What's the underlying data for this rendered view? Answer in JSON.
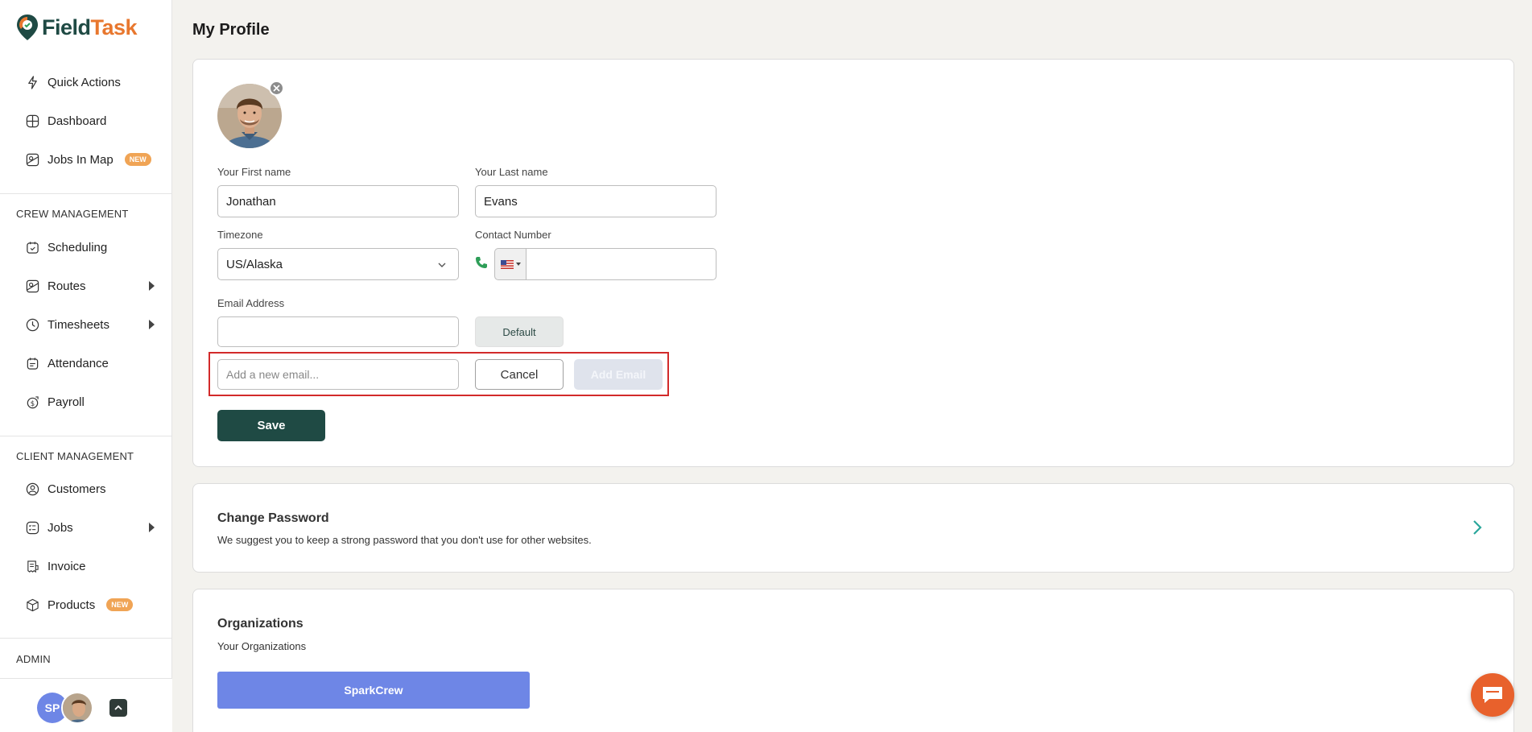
{
  "brand": {
    "name_part1": "Field",
    "name_part2": "Task",
    "primary_color": "#1f4a44",
    "accent_color": "#e8772e"
  },
  "sidebar": {
    "top_items": [
      {
        "label": "Quick Actions",
        "icon": "bolt-icon"
      },
      {
        "label": "Dashboard",
        "icon": "dashboard-icon"
      },
      {
        "label": "Jobs In Map",
        "icon": "map-icon",
        "badge": "NEW"
      }
    ],
    "crew_section": "CREW MANAGEMENT",
    "crew_items": [
      {
        "label": "Scheduling",
        "icon": "calendar-icon"
      },
      {
        "label": "Routes",
        "icon": "route-icon",
        "expandable": true
      },
      {
        "label": "Timesheets",
        "icon": "clock-icon",
        "expandable": true
      },
      {
        "label": "Attendance",
        "icon": "attendance-icon"
      },
      {
        "label": "Payroll",
        "icon": "payroll-icon"
      }
    ],
    "client_section": "CLIENT MANAGEMENT",
    "client_items": [
      {
        "label": "Customers",
        "icon": "customers-icon"
      },
      {
        "label": "Jobs",
        "icon": "jobs-icon",
        "expandable": true
      },
      {
        "label": "Invoice",
        "icon": "invoice-icon"
      },
      {
        "label": "Products",
        "icon": "box-icon",
        "badge": "NEW"
      }
    ],
    "admin_section": "ADMIN",
    "footer": {
      "initials": "SP"
    }
  },
  "page": {
    "title": "My Profile"
  },
  "profile": {
    "first_name_label": "Your First name",
    "first_name": "Jonathan",
    "last_name_label": "Your Last name",
    "last_name": "Evans",
    "timezone_label": "Timezone",
    "timezone": "US/Alaska",
    "contact_label": "Contact Number",
    "contact_value": "",
    "email_label": "Email Address",
    "email_value": "",
    "default_button": "Default",
    "new_email_placeholder": "Add a new email...",
    "cancel_button": "Cancel",
    "add_email_button": "Add Email",
    "save_button": "Save"
  },
  "password": {
    "title": "Change Password",
    "description": "We suggest you to keep a strong password that you don't use for other websites."
  },
  "organizations": {
    "title": "Organizations",
    "subtitle": "Your Organizations",
    "items": [
      "SparkCrew"
    ]
  }
}
